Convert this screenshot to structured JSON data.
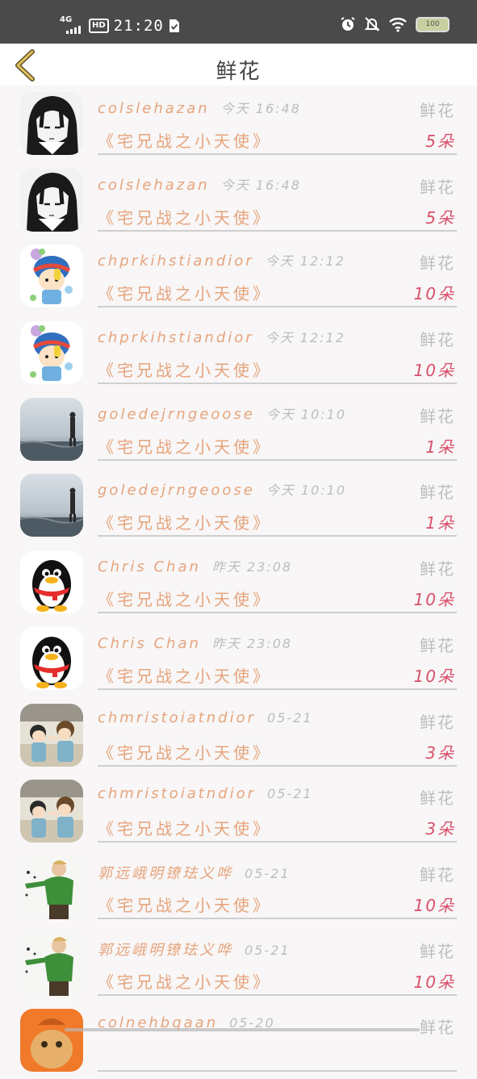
{
  "status_bar": {
    "network": "4G",
    "hd": "HD",
    "time": "21:20",
    "battery": "100"
  },
  "header": {
    "title": "鲜花"
  },
  "items": [
    {
      "username": "colslehazan",
      "time": "今天 16:48",
      "type": "鲜花",
      "book": "《宅兄战之小天使》",
      "count": "5朵",
      "avatar": "anime-boy"
    },
    {
      "username": "colslehazan",
      "time": "今天 16:48",
      "type": "鲜花",
      "book": "《宅兄战之小天使》",
      "count": "5朵",
      "avatar": "anime-boy"
    },
    {
      "username": "chprkihstiandior",
      "time": "今天 12:12",
      "type": "鲜花",
      "book": "《宅兄战之小天使》",
      "count": "10朵",
      "avatar": "cartoon-kid"
    },
    {
      "username": "chprkihstiandior",
      "time": "今天 12:12",
      "type": "鲜花",
      "book": "《宅兄战之小天使》",
      "count": "10朵",
      "avatar": "cartoon-kid"
    },
    {
      "username": "goledejrngeoose",
      "time": "今天 10:10",
      "type": "鲜花",
      "book": "《宅兄战之小天使》",
      "count": "1朵",
      "avatar": "seaside"
    },
    {
      "username": "goledejrngeoose",
      "time": "今天 10:10",
      "type": "鲜花",
      "book": "《宅兄战之小天使》",
      "count": "1朵",
      "avatar": "seaside"
    },
    {
      "username": "Chris Chan",
      "time": "昨天 23:08",
      "type": "鲜花",
      "book": "《宅兄战之小天使》",
      "count": "10朵",
      "avatar": "penguin"
    },
    {
      "username": "Chris Chan",
      "time": "昨天 23:08",
      "type": "鲜花",
      "book": "《宅兄战之小天使》",
      "count": "10朵",
      "avatar": "penguin"
    },
    {
      "username": "chmristoiatndior",
      "time": "05-21",
      "type": "鲜花",
      "book": "《宅兄战之小天使》",
      "count": "3朵",
      "avatar": "anime-kids"
    },
    {
      "username": "chmristoiatndior",
      "time": "05-21",
      "type": "鲜花",
      "book": "《宅兄战之小天使》",
      "count": "3朵",
      "avatar": "anime-kids"
    },
    {
      "username": "郭远峨明镣珐义哗",
      "time": "05-21",
      "type": "鲜花",
      "book": "《宅兄战之小天使》",
      "count": "10朵",
      "avatar": "green-person"
    },
    {
      "username": "郭远峨明镣珐义哗",
      "time": "05-21",
      "type": "鲜花",
      "book": "《宅兄战之小天使》",
      "count": "10朵",
      "avatar": "green-person"
    },
    {
      "username": "colnehbqaan",
      "time": "05-20",
      "type": "鲜花",
      "book": "",
      "count": "",
      "avatar": "orange-cartoon"
    }
  ],
  "colors": {
    "username": "#e6a47c",
    "count": "#d9506a",
    "muted": "#bdbdbd",
    "back_arrow": "#e0c25a"
  }
}
